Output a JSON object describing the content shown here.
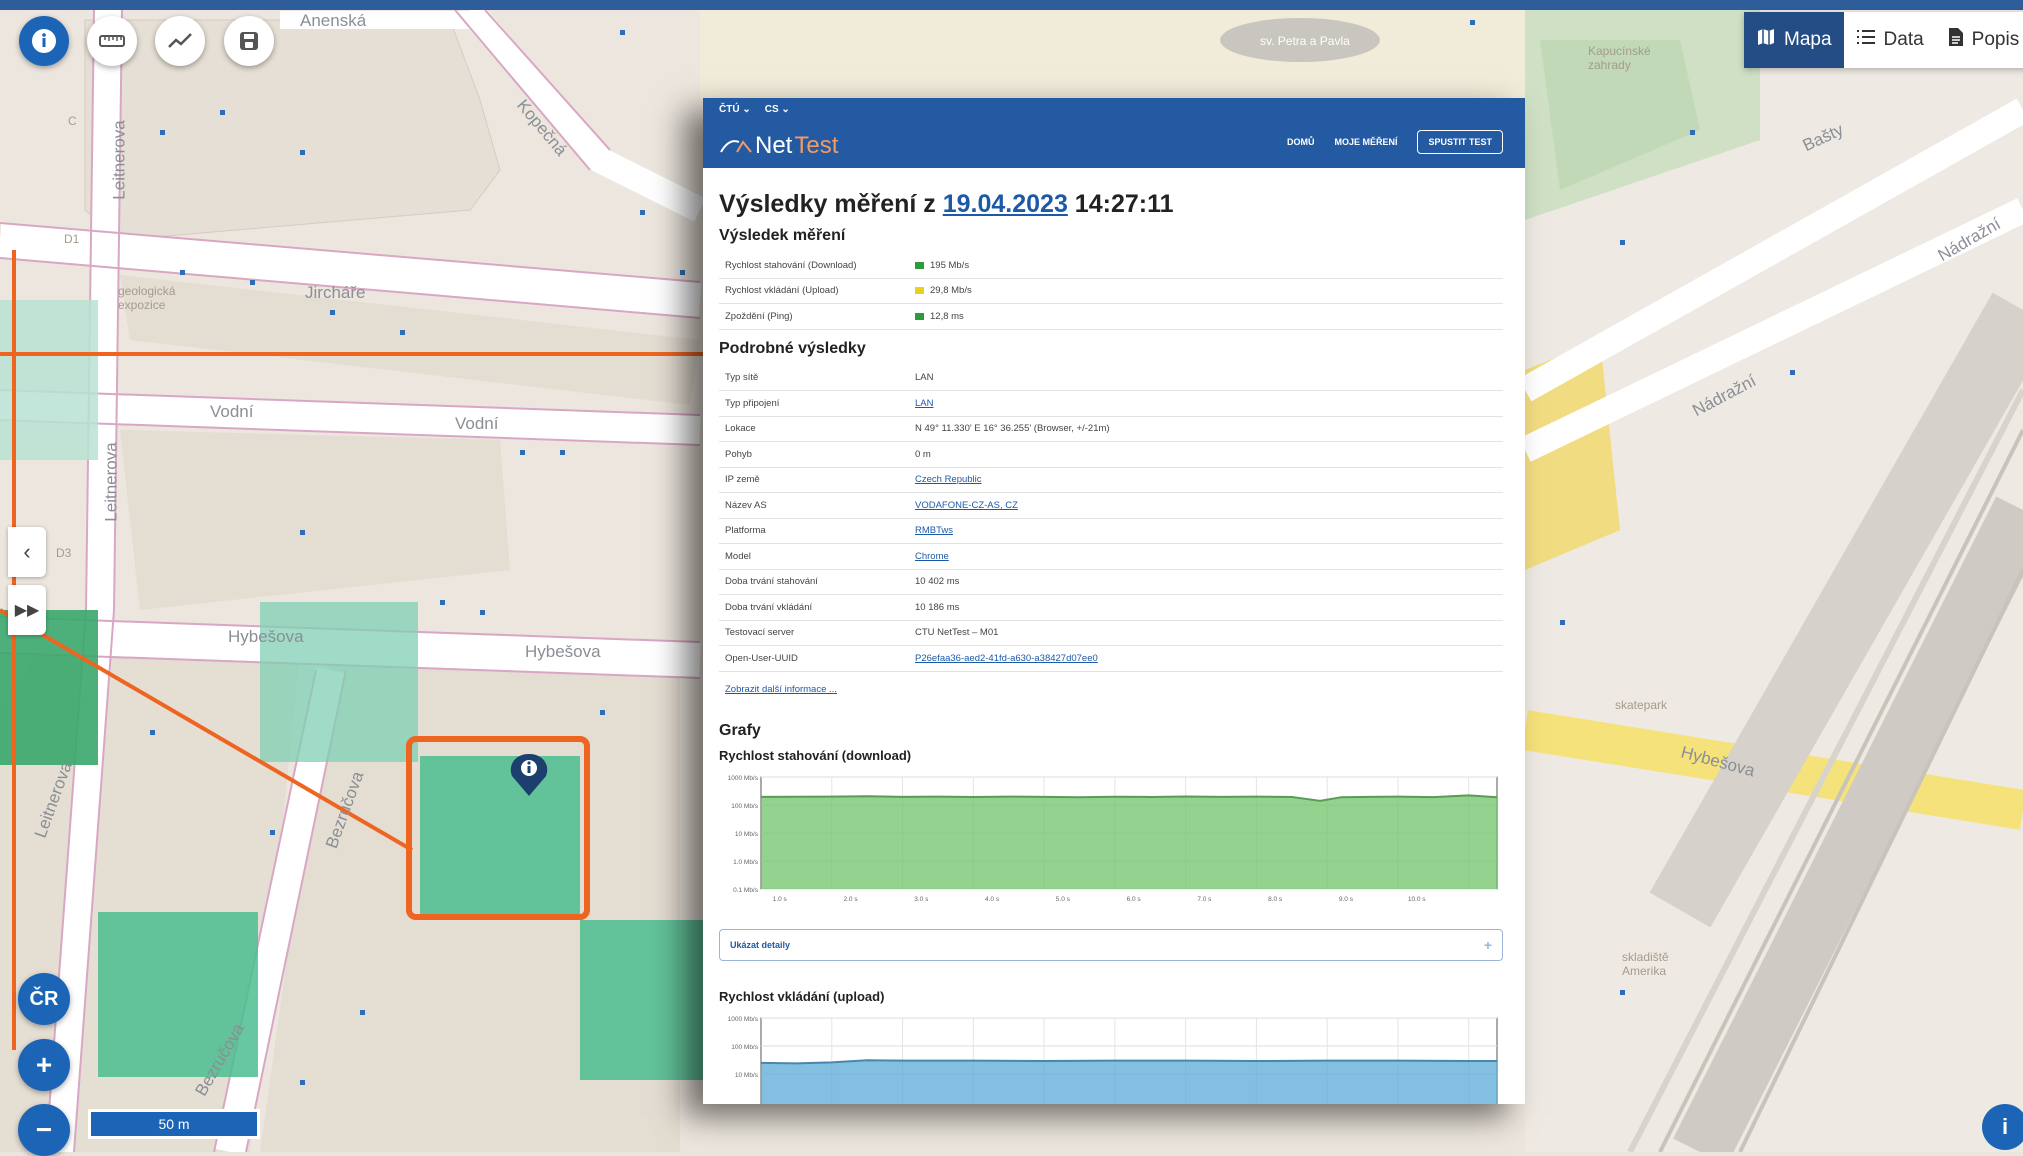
{
  "map": {
    "streets": [
      "Anenská",
      "Kopečná",
      "Leitnerova",
      "Jircháře",
      "Vodní",
      "Vodní",
      "Hybešova",
      "Hybešova",
      "Bezručova",
      "Bezručova",
      "Leitnerova",
      "Leitnerova",
      "Bašty",
      "Nádražní",
      "Nádražní",
      "Hybešova"
    ],
    "labels": [
      "geologická expozice",
      "D1",
      "D3",
      "Kapucínské zahrady",
      "sv. Petra a Pavla",
      "skatepark",
      "skladiště Amerika",
      "C"
    ],
    "scale_label": "50 m",
    "region_button": "ČR",
    "zoom_in": "+",
    "zoom_out": "−",
    "info_fab": "i"
  },
  "toolbar": {
    "buttons": [
      "info-icon",
      "ruler-icon",
      "chart-line-icon",
      "save-icon"
    ]
  },
  "view_tabs": [
    {
      "label": "Mapa",
      "icon": "map-icon",
      "active": true
    },
    {
      "label": "Data",
      "icon": "list-icon",
      "active": false
    },
    {
      "label": "Popis",
      "icon": "document-icon",
      "active": false
    }
  ],
  "nettest": {
    "lang": [
      "ČTÚ ⌄",
      "CS ⌄"
    ],
    "logo_net": "Net",
    "logo_test": "Test",
    "nav": [
      "DOMŮ",
      "MOJE MĚŘENÍ"
    ],
    "run_button": "SPUSTIT TEST",
    "title_prefix": "Výsledky měření z ",
    "title_date": "19.04.2023",
    "title_time": " 14:27:11",
    "result_heading": "Výsledek měření",
    "results": [
      {
        "key": "Rychlost stahování (Download)",
        "value": "195 Mb/s",
        "color": "#2e9b3e"
      },
      {
        "key": "Rychlost vkládání (Upload)",
        "value": "29,8 Mb/s",
        "color": "#e8d21c"
      },
      {
        "key": "Zpoždění (Ping)",
        "value": "12,8 ms",
        "color": "#2e9b3e"
      }
    ],
    "details_heading": "Podrobné výsledky",
    "details": [
      {
        "key": "Typ sítě",
        "value": "LAN",
        "link": false
      },
      {
        "key": "Typ připojení",
        "value": "LAN",
        "link": true
      },
      {
        "key": "Lokace",
        "value": "N 49° 11.330' E 16° 36.255' (Browser, +/-21m)",
        "link": false
      },
      {
        "key": "Pohyb",
        "value": "0 m",
        "link": false
      },
      {
        "key": "IP země",
        "value": "Czech Republic",
        "link": true
      },
      {
        "key": "Název AS",
        "value": "VODAFONE-CZ-AS, CZ",
        "link": true
      },
      {
        "key": "Platforma",
        "value": "RMBTws",
        "link": true
      },
      {
        "key": "Model",
        "value": "Chrome",
        "link": true
      },
      {
        "key": "Doba trvání stahování",
        "value": "10 402 ms",
        "link": false
      },
      {
        "key": "Doba trvání vkládání",
        "value": "10 186 ms",
        "link": false
      },
      {
        "key": "Testovací server",
        "value": "CTU NetTest – M01",
        "link": false
      },
      {
        "key": "Open-User-UUID",
        "value": "P26efaa36-aed2-41fd-a630-a38427d07ee0",
        "link": true
      }
    ],
    "more_link": "Zobrazit další informace ...",
    "graphs_heading": "Grafy",
    "download_chart_title": "Rychlost stahování (download)",
    "upload_chart_title": "Rychlost vkládání (upload)",
    "show_details": "Ukázat detaily",
    "show_details_plus": "+"
  },
  "chart_data": [
    {
      "type": "area",
      "title": "Rychlost stahování (download)",
      "y_scale": "log",
      "ylim": [
        0.1,
        1000
      ],
      "y_ticks": [
        "1000 Mb/s",
        "100 Mb/s",
        "10 Mb/s",
        "1.0 Mb/s",
        "0.1 Mb/s"
      ],
      "x_ticks": [
        "1.0 s",
        "2.0 s",
        "3.0 s",
        "4.0 s",
        "5.0 s",
        "6.0 s",
        "7.0 s",
        "8.0 s",
        "9.0 s",
        "10.0 s"
      ],
      "xlim": [
        0,
        10.4
      ],
      "color": "#6fc36a",
      "x": [
        0,
        0.5,
        1,
        1.5,
        2,
        2.5,
        3,
        3.5,
        4,
        4.5,
        5,
        5.5,
        6,
        6.5,
        7,
        7.5,
        7.9,
        8.2,
        8.6,
        9,
        9.5,
        10,
        10.4
      ],
      "values": [
        195,
        198,
        200,
        205,
        196,
        200,
        194,
        200,
        196,
        190,
        198,
        194,
        202,
        195,
        200,
        194,
        140,
        190,
        196,
        200,
        192,
        220,
        190
      ]
    },
    {
      "type": "area",
      "title": "Rychlost vkládání (upload)",
      "y_scale": "log",
      "ylim": [
        0.1,
        1000
      ],
      "y_ticks": [
        "1000 Mb/s",
        "100 Mb/s",
        "10 Mb/s"
      ],
      "xlim": [
        0,
        10.4
      ],
      "color": "#5aa9d6",
      "x": [
        0,
        0.5,
        1,
        1.5,
        2,
        3,
        4,
        5,
        6,
        7,
        8,
        9,
        10,
        10.4
      ],
      "values": [
        25,
        24,
        26,
        31,
        30,
        30,
        29,
        30,
        30,
        29,
        30,
        30,
        29,
        29
      ]
    }
  ]
}
